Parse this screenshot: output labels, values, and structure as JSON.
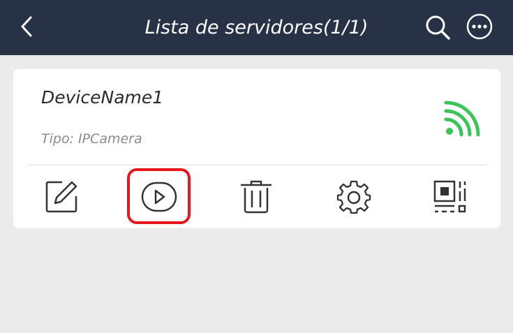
{
  "header": {
    "title": "Lista de servidores(1/1)",
    "icons": {
      "back": "chevron-left-icon",
      "search": "search-icon",
      "more": "more-options-icon"
    }
  },
  "device": {
    "name": "DeviceName1",
    "type_text": "Tipo: IPCamera",
    "status_icon": "online-signal-icon",
    "status_color": "#3cc459"
  },
  "actions": [
    {
      "icon": "edit-icon"
    },
    {
      "icon": "play-icon",
      "highlighted": true
    },
    {
      "icon": "trash-icon"
    },
    {
      "icon": "gear-icon"
    },
    {
      "icon": "qr-code-icon"
    }
  ],
  "colors": {
    "header_bg": "#273246",
    "page_bg": "#ebebeb",
    "highlight": "#e8141e",
    "icon_stroke": "#333333"
  }
}
